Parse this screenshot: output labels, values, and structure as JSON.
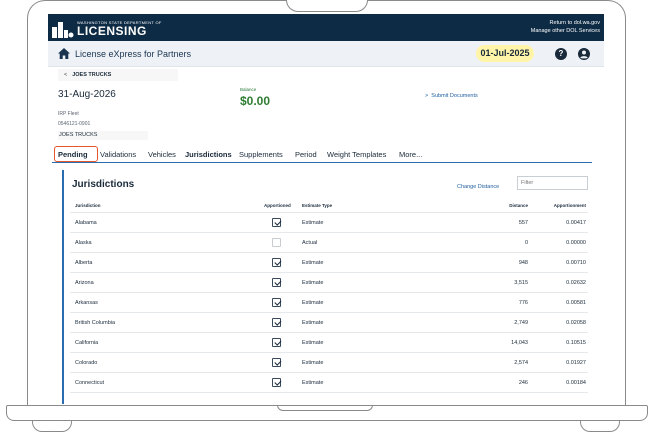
{
  "header": {
    "logo_small": "WASHINGTON STATE DEPARTMENT OF",
    "logo_big": "LICENSING",
    "link_return": "Return to dol.wa.gov",
    "link_manage": "Manage other DOL Services"
  },
  "app_bar": {
    "title": "License eXpress for Partners",
    "date": "01-Jul-2025",
    "help_glyph": "?"
  },
  "account": {
    "breadcrumb": "JOES TRUCKS",
    "breadcrumb_chevron": "<",
    "expiration": "31-Aug-2026",
    "balance_label": "Balance",
    "balance_value": "$0.00",
    "submit_docs_chevron": ">",
    "submit_docs": "Submit Documents",
    "fleet_type": "IRP Fleet",
    "account_number": "0546121-0901",
    "name": "JOES TRUCKS"
  },
  "tabs": [
    "Pending",
    "Validations",
    "Vehicles",
    "Jurisdictions",
    "Supplements",
    "Period",
    "Weight Templates",
    "More..."
  ],
  "active_tab": "Jurisdictions",
  "highlighted_tab": "Pending",
  "jurisdictions": {
    "title": "Jurisdictions",
    "change_distance": "Change Distance",
    "filter_placeholder": "Filter",
    "columns": [
      "Jurisdiction",
      "Apportioned",
      "Estimate Type",
      "Distance",
      "Apportionment"
    ],
    "rows": [
      {
        "name": "Alabama",
        "apportioned": true,
        "type": "Estimate",
        "distance": "557",
        "apportionment": "0.00417"
      },
      {
        "name": "Alaska",
        "apportioned": false,
        "type": "Actual",
        "distance": "0",
        "apportionment": "0.00000"
      },
      {
        "name": "Alberta",
        "apportioned": true,
        "type": "Estimate",
        "distance": "948",
        "apportionment": "0.00710"
      },
      {
        "name": "Arizona",
        "apportioned": true,
        "type": "Estimate",
        "distance": "3,515",
        "apportionment": "0.02632"
      },
      {
        "name": "Arkansas",
        "apportioned": true,
        "type": "Estimate",
        "distance": "776",
        "apportionment": "0.00581"
      },
      {
        "name": "British Columbia",
        "apportioned": true,
        "type": "Estimate",
        "distance": "2,749",
        "apportionment": "0.02058"
      },
      {
        "name": "California",
        "apportioned": true,
        "type": "Estimate",
        "distance": "14,043",
        "apportionment": "0.10515"
      },
      {
        "name": "Colorado",
        "apportioned": true,
        "type": "Estimate",
        "distance": "2,574",
        "apportionment": "0.01927"
      },
      {
        "name": "Connecticut",
        "apportioned": true,
        "type": "Estimate",
        "distance": "246",
        "apportionment": "0.00184"
      }
    ]
  },
  "colors": {
    "banner": "#0e2b45",
    "accent": "#2b6cb0",
    "date_pill": "#fff4a8",
    "balance": "#2e7d32",
    "highlight_box": "#e4572e"
  }
}
